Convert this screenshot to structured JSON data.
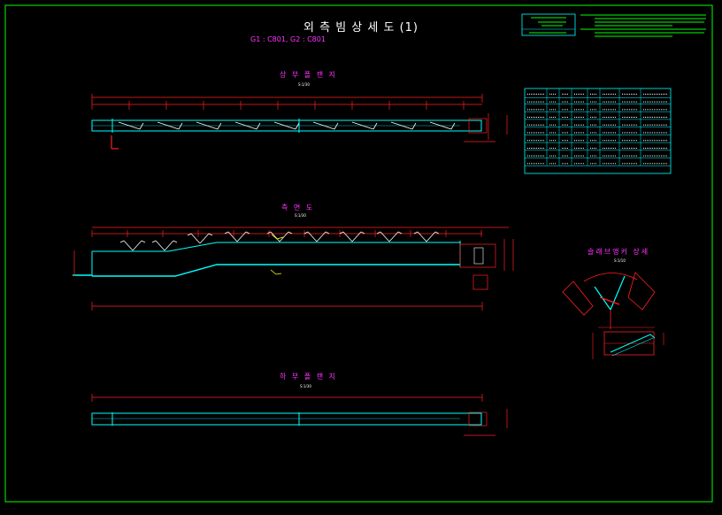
{
  "drawing": {
    "title": "외 측 빔 상 세 도 (1)",
    "subtitle": "G1 : C801, G2 : C801"
  },
  "views": {
    "top_flange": {
      "title": "상 부 플 랜 지",
      "scale": "S:1/30"
    },
    "elevation": {
      "title": "측 면 도",
      "scale": "S:1/30"
    },
    "bottom_flange": {
      "title": "하 부 플 랜 지",
      "scale": "S:1/30"
    },
    "stud_detail": {
      "title": "슬래브앵커 상세",
      "scale": "S:1/10"
    }
  },
  "colors": {
    "frame": "#00ff00",
    "dimension": "#ff2020",
    "outline": "#00ffff",
    "anchor": "#ffffff",
    "label": "#ff33ff",
    "table_line": "#00ffff",
    "table_text": "#ffffff"
  },
  "table": {
    "rows": 9,
    "cols": 8
  }
}
